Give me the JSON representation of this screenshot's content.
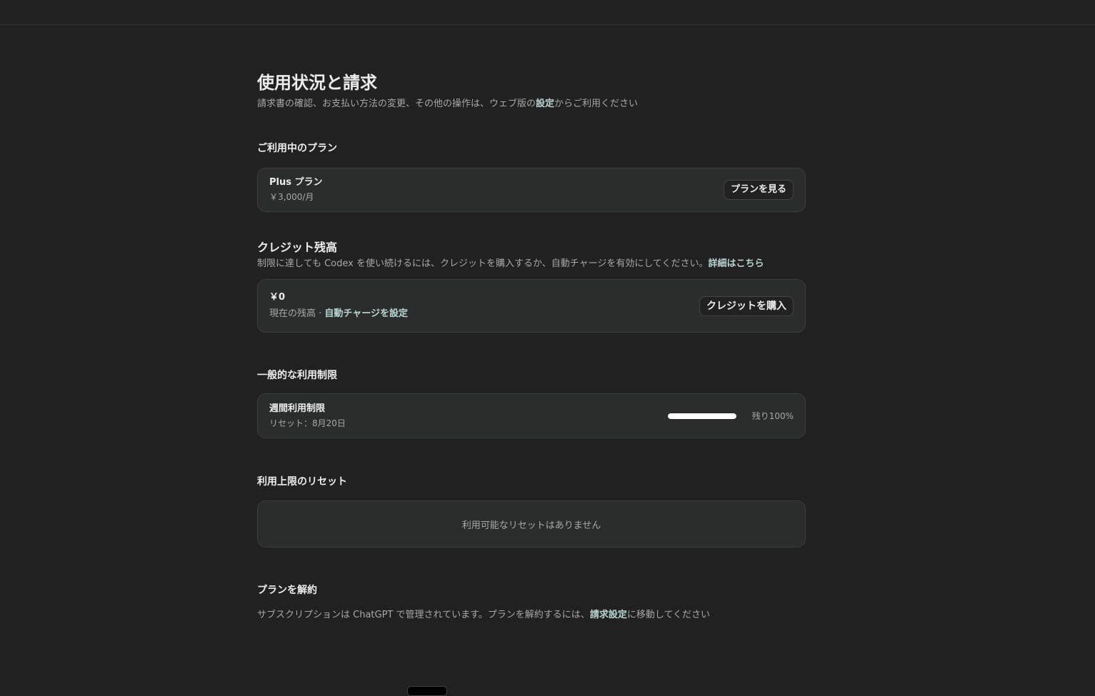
{
  "page": {
    "title": "使用状況と請求",
    "subtitle_before": "請求書の確認、お支払い方法の変更、その他の操作は、ウェブ版の",
    "subtitle_link": "設定",
    "subtitle_after": "からご利用ください"
  },
  "current_plan": {
    "section_title": "ご利用中のプラン",
    "plan_name": "Plus プラン",
    "plan_price": "￥3,000/月",
    "view_plans_button": "プランを見る"
  },
  "credits": {
    "section_title": "クレジット残高",
    "desc": "制限に達しても Codex を使い続けるには、クレジットを購入するか、自動チャージを有効にしてください。",
    "desc_link": "詳細はこちら",
    "balance": "￥0",
    "balance_label": "現在の残高 · ",
    "auto_charge_link": "自動チャージを設定",
    "buy_button": "クレジットを購入"
  },
  "limits": {
    "section_title": "一般的な利用制限",
    "weekly_title": "週間利用制限",
    "reset_text": "リセット：8月20日",
    "remaining_percent": 100,
    "remaining_label": "残り100%"
  },
  "reset": {
    "section_title": "利用上限のリセット",
    "empty_text": "利用可能なリセットはありません"
  },
  "cancel": {
    "section_title": "プランを解約",
    "text_before": "サブスクリプションは ChatGPT で管理されています。プランを解約するには、",
    "link": "請求設定",
    "text_after": "に移動してください"
  },
  "colors": {
    "background": "#212121",
    "card": "#2b2d2d",
    "link": "#b8d4d0"
  }
}
